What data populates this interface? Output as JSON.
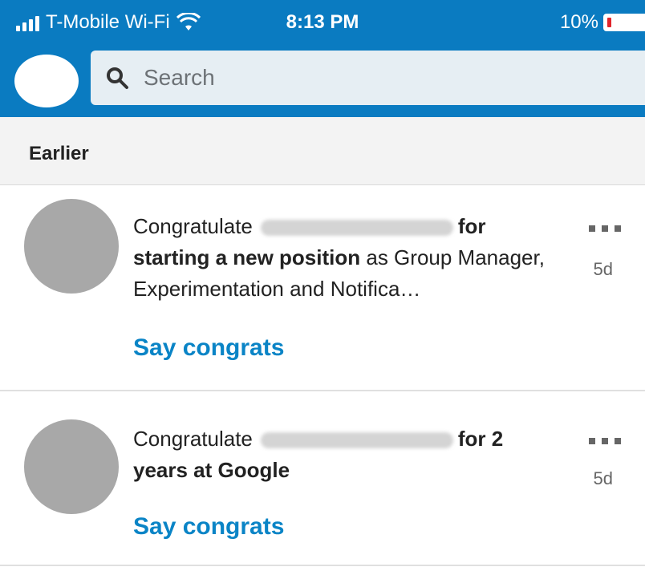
{
  "status_bar": {
    "carrier": "T-Mobile Wi-Fi",
    "time": "8:13 PM",
    "battery": "10%"
  },
  "colors": {
    "brand": "#0a7bc1",
    "link": "#0a84c6"
  },
  "search": {
    "placeholder": "Search"
  },
  "section": {
    "title": "Earlier"
  },
  "notifications": [
    {
      "lead": "Congratulate",
      "bold1": "for",
      "bold2": "starting a new position",
      "rest": "as Group Manager, Experimentation and Notifica…",
      "age": "5d",
      "action": "Say congrats"
    },
    {
      "lead": "Congratulate",
      "bold1": "for 2",
      "bold2": "years at Google",
      "age": "5d",
      "action": "Say congrats"
    }
  ]
}
